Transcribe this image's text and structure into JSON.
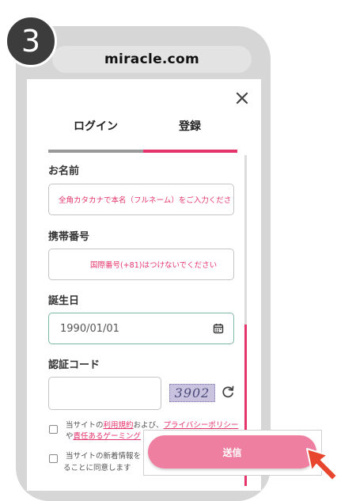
{
  "step_number": "3",
  "browser": {
    "url": "miracle.com"
  },
  "modal": {
    "tabs": [
      {
        "label": "ログイン",
        "active": false
      },
      {
        "label": "登録",
        "active": true
      }
    ]
  },
  "form": {
    "name": {
      "label": "お名前",
      "placeholder": "全角カタカナで本名（フルネーム）をご入力ください"
    },
    "phone": {
      "label": "携帯番号",
      "placeholder": "国際番号(+81)はつけないでください"
    },
    "birthday": {
      "label": "誕生日",
      "value": "1990/01/01"
    },
    "captcha": {
      "label": "認証コード",
      "code": "3902"
    },
    "consent_1": {
      "before_terms": "当サイトの",
      "terms_link": "利用規約",
      "between": "および、",
      "privacy_link": "プライバシーポリシー",
      "after_privacy": "や",
      "responsible_link": "責任あるゲーミング"
    },
    "consent_2": {
      "line_1": "当サイトの新着情報を",
      "line_2": "ることに同意します"
    },
    "submit_label": "送信"
  },
  "colors": {
    "accent": "#e5336b",
    "submit": "#ef7fa0",
    "cursor": "#e8452f"
  }
}
